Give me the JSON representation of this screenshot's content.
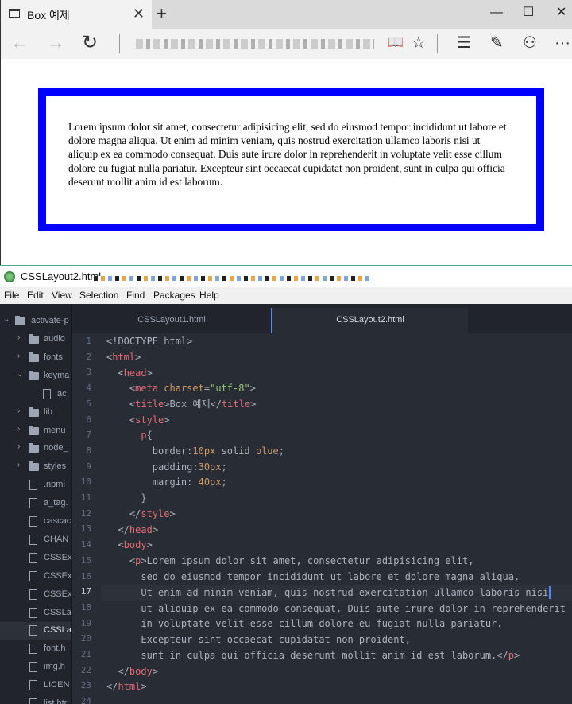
{
  "browser": {
    "tab_title": "Box 예제",
    "close_glyph": "✕",
    "new_tab_glyph": "+",
    "controls": {
      "minimize": "—",
      "maximize": "☐",
      "close": "✕"
    },
    "nav": {
      "back": "←",
      "forward": "→",
      "refresh": "↻"
    },
    "tools": {
      "reading_view": "📖",
      "favorite": "☆",
      "hub": "☰",
      "notes": "✎",
      "share": "⚇",
      "more": "···"
    },
    "page_paragraph": "Lorem ipsum dolor sit amet, consectetur adipisicing elit, sed do eiusmod tempor incididunt ut labore et dolore magna aliqua. Ut enim ad minim veniam, quis nostrud exercitation ullamco laboris nisi ut aliquip ex ea commodo consequat. Duis aute irure dolor in reprehenderit in voluptate velit esse cillum dolore eu fugiat nulla pariatur. Excepteur sint occaecat cupidatat non proident, sunt in culpa qui officia deserunt mollit anim id est laborum.",
    "paragraph_border_color": "#0000ff"
  },
  "atom": {
    "window_title": "CSSLayout2.html —",
    "menu": [
      "File",
      "Edit",
      "View",
      "Selection",
      "Find",
      "Packages",
      "Help"
    ],
    "tree": {
      "root": "activate-p",
      "items": [
        {
          "label": "audio",
          "kind": "folder"
        },
        {
          "label": "fonts",
          "kind": "folder"
        },
        {
          "label": "keyma",
          "kind": "folder-open"
        },
        {
          "label": "ac",
          "kind": "file-nested"
        },
        {
          "label": "lib",
          "kind": "folder"
        },
        {
          "label": "menu",
          "kind": "folder"
        },
        {
          "label": "node_",
          "kind": "folder"
        },
        {
          "label": "styles",
          "kind": "folder"
        },
        {
          "label": ".npmi",
          "kind": "file"
        },
        {
          "label": "a_tag.",
          "kind": "file"
        },
        {
          "label": "cascac",
          "kind": "file"
        },
        {
          "label": "CHAN",
          "kind": "file"
        },
        {
          "label": "CSSEx",
          "kind": "file"
        },
        {
          "label": "CSSEx",
          "kind": "file"
        },
        {
          "label": "CSSEx",
          "kind": "file"
        },
        {
          "label": "CSSLa",
          "kind": "file"
        },
        {
          "label": "CSSLa",
          "kind": "file"
        },
        {
          "label": "font.h",
          "kind": "file"
        },
        {
          "label": "img.h",
          "kind": "file"
        },
        {
          "label": "LICEN",
          "kind": "file"
        },
        {
          "label": "list.htr",
          "kind": "file"
        }
      ]
    },
    "tabs": [
      "CSSLayout1.html",
      "CSSLayout2.html"
    ],
    "current_line": 17,
    "line_numbers": [
      "1",
      "2",
      "3",
      "4",
      "5",
      "6",
      "7",
      "8",
      "9",
      "10",
      "11",
      "12",
      "13",
      "14",
      "15",
      "16",
      "17",
      "18",
      "19",
      "20",
      "21",
      "22",
      "23",
      "24"
    ],
    "code": {
      "l1": "<!DOCTYPE html>",
      "l2_tag": "html",
      "l3_tag": "head",
      "l4_tag": "meta",
      "l4_attr": "charset",
      "l4_val": "\"utf-8\"",
      "l5_tag": "title",
      "l5_text": "Box 예제",
      "l6_tag": "style",
      "l7_sel": "p",
      "l8_prop": "border:",
      "l8_num": "10px",
      "l8_rest": " solid ",
      "l8_kw": "blue",
      "l8_end": ";",
      "l9_prop": "padding:",
      "l9_num": "30px",
      "l9_end": ";",
      "l10_prop": "margin: ",
      "l10_num": "40px",
      "l10_end": ";",
      "l11": "}",
      "l12_tag": "style",
      "l13_tag": "head",
      "l14_tag": "body",
      "l15_tag": "p",
      "l15_text": "Lorem ipsum dolor sit amet, consectetur adipisicing elit,",
      "l16": "sed do eiusmod tempor incididunt ut labore et dolore magna aliqua.",
      "l17": "Ut enim ad minim veniam, quis nostrud exercitation ullamco laboris nisi",
      "l18": "ut aliquip ex ea commodo consequat. Duis aute irure dolor in reprehenderit",
      "l19": "in voluptate velit esse cillum dolore eu fugiat nulla pariatur.",
      "l20": "Excepteur sint occaecat cupidatat non proident,",
      "l21_text": "sunt in culpa qui officia deserunt mollit anim id est laborum.",
      "l21_tag": "p",
      "l22_tag": "body",
      "l23_tag": "html"
    }
  }
}
